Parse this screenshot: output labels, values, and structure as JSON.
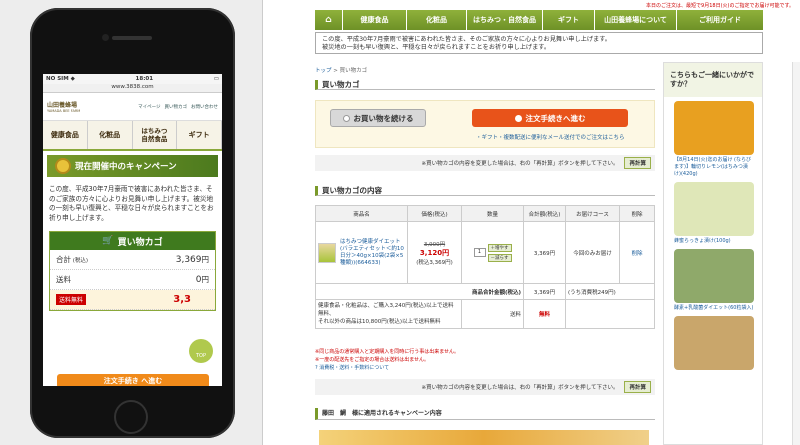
{
  "mobile": {
    "status": {
      "carrier": "NO SIM ◆",
      "time": "18:01",
      "battery": "▭"
    },
    "url": "www.3838.com",
    "logo": "山田養蜂場",
    "logo_sub": "YAMADA BEE FARM",
    "header_icons": [
      "マイページ",
      "買い物カゴ",
      "お問い合わせ"
    ],
    "nav": [
      "健康食品",
      "化粧品",
      "はちみつ\n自然食品",
      "ギフト"
    ],
    "campaign": "現在開催中のキャンペーン",
    "notice": "この度、平成30年7月豪雨で被害にあわれた皆さま、そのご家族の方々に心よりお見舞い申し上げます。被災地の一刻も早い復興と、平穏な日々が戻られますことをお祈り申し上げます。",
    "cart_title": "買い物カゴ",
    "subtotal_label": "合計",
    "subtotal_tax": "(税込)",
    "subtotal_value": "3,369",
    "subtotal_unit": "円",
    "shipping_label": "送料",
    "shipping_value": "0",
    "shipping_unit": "円",
    "free_tag": "送料無料",
    "total_partial": "3,3",
    "top_button": "TOP",
    "proceed_button": "注文手続き へ進む"
  },
  "desktop": {
    "top_notice": "本日のご注文は、最短で9月18日(火)のご指定でお届け可能です。",
    "nav": [
      "健康食品",
      "化粧品",
      "はちみつ・自然食品",
      "ギフト",
      "山田養蜂場について",
      "ご利用ガイド"
    ],
    "notice_line1": "この度、平成30年7月豪雨で被害にあわれた皆さま、そのご家族の方々に心よりお見舞い申し上げます。",
    "notice_line2": "被災地の一刻も早い復興と、平穏な日々が戻られますことをお祈り申し上げます。",
    "breadcrumb_home": "トップ",
    "breadcrumb_sep": ">",
    "breadcrumb_current": "買い物カゴ",
    "cart_title": "買い物カゴ",
    "continue_button": "お買い物を続ける",
    "checkout_button": "注文手続きへ進む",
    "gift_link": "・ギフト・複数配送に便利なメール送付でのご注文はこちら",
    "recalc_text": "※買い物カゴの内容を変更した場合は、右の「再計算」ボタンを押して下さい。",
    "recalc_button": "再計算",
    "contents_title": "買い物カゴの内容",
    "table_headers": [
      "商品名",
      "価格(税込)",
      "数量",
      "合計額(税込)",
      "お届けコース",
      "削除"
    ],
    "item_name": "はちみつ健康ダイエット(バラエティセット＜約10日分＞40g×10袋(2袋×5種類))(664633)",
    "item_old_price": "3,900円",
    "item_new_price": "3,120円",
    "item_price_tax": "(税込3,369円)",
    "item_qty": "1",
    "qty_up": "＋増やす",
    "qty_down": "－減らす",
    "item_total": "3,369円",
    "item_course": "今回のみお届け",
    "item_delete": "削除",
    "goods_total_label": "商品合計金額(税込)",
    "goods_total_value": "3,369円",
    "goods_total_note": "(うち消費税249円)",
    "shipping_note_line1": "健康食品・化粧品は、ご購入3,240円(税込)以上で送料無料、",
    "shipping_note_line2": "それ以外の商品は10,800円(税込)以上で送料無料",
    "shipping_label": "送料",
    "shipping_value": "無料",
    "note1": "※同じ商品の通常購入と定期購入を同時に行う事は出来ません。",
    "note2": "※一度の配送先をご指定の場合は送料は出ません。",
    "note3": "消費税・送料・手数料について",
    "recalc_text2": "※買い物カゴの内容を変更した場合は、右の「再計算」ボタンを押して下さい。",
    "campaign_title": "藤田　鯛　様に適用されるキャンペーン内容",
    "side_header": "こちらもご一緒にいかがですか？",
    "side_items": [
      {
        "name": "【8月14日(火)迄のお届け (ならびます)】輪切りレモン(はちみつ漬け)(420g)",
        "color": "#e8a020"
      },
      {
        "name": "蜂蜜らっきょ漬け(100g)",
        "color": "#dfe7b8"
      },
      {
        "name": "酵素+乳酸菌ダイエット(60粒袋入)",
        "color": "#8fa96a"
      },
      {
        "name": "",
        "color": "#c9a66b"
      }
    ]
  }
}
